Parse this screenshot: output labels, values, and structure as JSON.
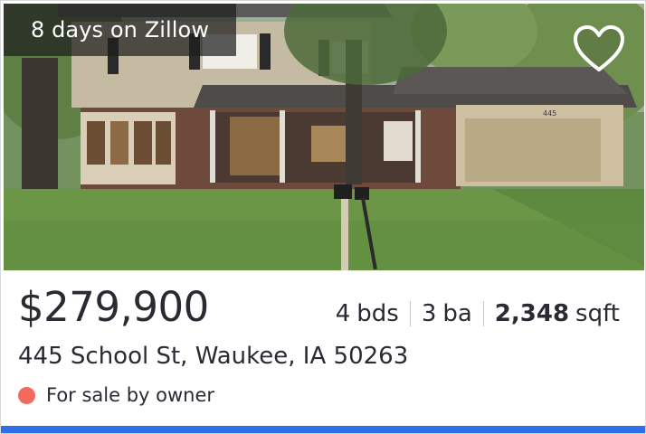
{
  "listing": {
    "days_on_site": "8 days on Zillow",
    "price": "$279,900",
    "beds_num": "4",
    "beds_unit": "bds",
    "baths_num": "3",
    "baths_unit": "ba",
    "sqft_num": "2,348",
    "sqft_unit": "sqft",
    "address": "445 School St, Waukee, IA 50263",
    "status": "For sale by owner"
  },
  "photo": {
    "house_number": "445"
  },
  "icons": {
    "favorite": "heart-outline-icon",
    "status": "status-dot-icon"
  },
  "colors": {
    "status_dot": "#f26a5b",
    "accent_bar": "#2e6eea",
    "text": "#2a2a33"
  }
}
